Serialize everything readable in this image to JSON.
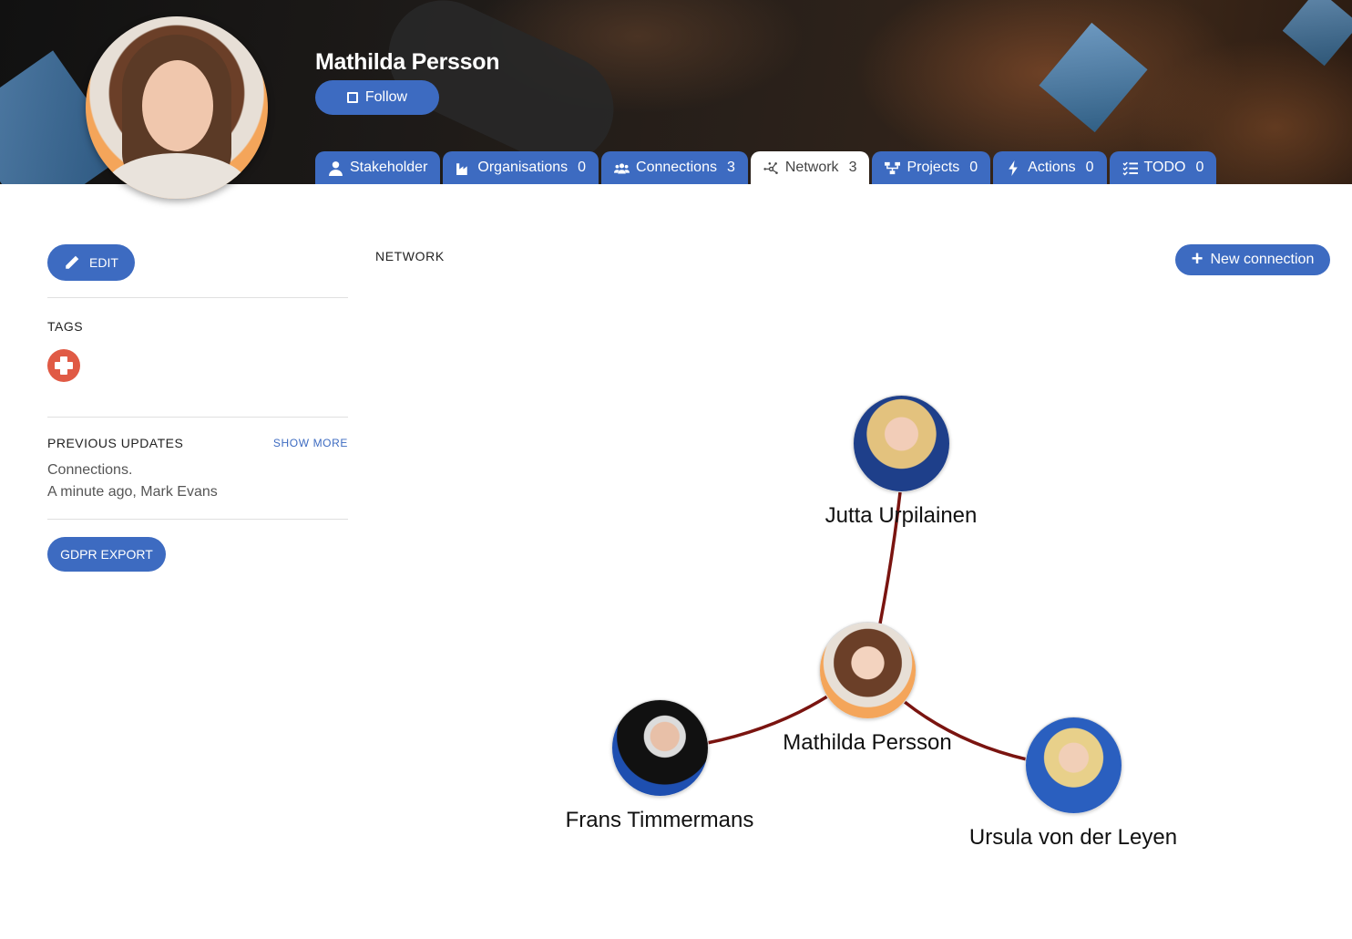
{
  "profile": {
    "name": "Mathilda Persson",
    "follow_label": "Follow"
  },
  "tabs": [
    {
      "label": "Stakeholder",
      "count": "",
      "icon": "user-icon"
    },
    {
      "label": "Organisations",
      "count": "0",
      "icon": "factory-icon"
    },
    {
      "label": "Connections",
      "count": "3",
      "icon": "users-icon"
    },
    {
      "label": "Network",
      "count": "3",
      "icon": "network-icon",
      "active": true
    },
    {
      "label": "Projects",
      "count": "0",
      "icon": "sitemap-icon"
    },
    {
      "label": "Actions",
      "count": "0",
      "icon": "bolt-icon"
    },
    {
      "label": "TODO",
      "count": "0",
      "icon": "checklist-icon"
    }
  ],
  "sidebar": {
    "edit_label": "EDIT",
    "tags_title": "TAGS",
    "updates_title": "PREVIOUS UPDATES",
    "show_more": "SHOW MORE",
    "update_text": "Connections.",
    "update_meta": "A minute ago, Mark Evans",
    "gdpr_label": "GDPR EXPORT"
  },
  "network": {
    "title": "NETWORK",
    "new_connection_label": "New connection",
    "edge_color": "#7a1410",
    "nodes": [
      {
        "name": "Jutta Urpilainen"
      },
      {
        "name": "Mathilda Persson"
      },
      {
        "name": "Frans Timmermans"
      },
      {
        "name": "Ursula von der Leyen"
      }
    ]
  },
  "colors": {
    "accent": "#3d6bc1",
    "add_tag": "#e05a45"
  }
}
